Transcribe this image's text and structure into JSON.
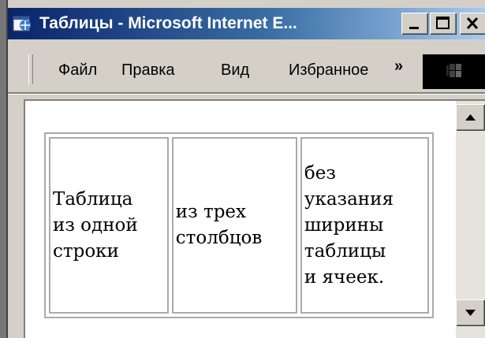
{
  "window": {
    "title": "Таблицы - Microsoft Internet E...",
    "title_color": "#ffffff",
    "titlebar_gradient": [
      "#0a246a",
      "#a6caf0"
    ]
  },
  "menu": {
    "items": [
      {
        "label": "Файл"
      },
      {
        "label": "Правка"
      },
      {
        "label": "Вид"
      },
      {
        "label": "Избранное"
      }
    ],
    "overflow": "»"
  },
  "table": {
    "cells": [
      {
        "lines": [
          "Таблица",
          "из одной",
          "строки"
        ]
      },
      {
        "lines": [
          "из трех",
          "столбцов"
        ]
      },
      {
        "lines": [
          "без",
          "указания",
          "ширины",
          "таблицы",
          "и ячеек."
        ]
      }
    ]
  }
}
